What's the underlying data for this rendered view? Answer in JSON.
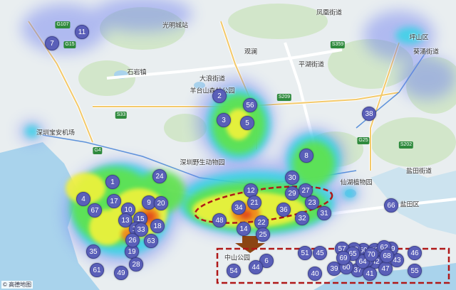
{
  "markers": [
    {
      "label": "1"
    },
    {
      "label": "2"
    },
    {
      "label": "3"
    },
    {
      "label": "4"
    },
    {
      "label": "5"
    },
    {
      "label": "6"
    },
    {
      "label": "7"
    },
    {
      "label": "8"
    },
    {
      "label": "9"
    },
    {
      "label": "10"
    },
    {
      "label": "11"
    },
    {
      "label": "12"
    },
    {
      "label": "13"
    },
    {
      "label": "14"
    },
    {
      "label": "15"
    },
    {
      "label": "16"
    },
    {
      "label": "17"
    },
    {
      "label": "18"
    },
    {
      "label": "19"
    },
    {
      "label": "20"
    },
    {
      "label": "21"
    },
    {
      "label": "22"
    },
    {
      "label": "23"
    },
    {
      "label": "24"
    },
    {
      "label": "25"
    },
    {
      "label": "26"
    },
    {
      "label": "27"
    },
    {
      "label": "28"
    },
    {
      "label": "29"
    },
    {
      "label": "30"
    },
    {
      "label": "31"
    },
    {
      "label": "32"
    },
    {
      "label": "33"
    },
    {
      "label": "34"
    },
    {
      "label": "35"
    },
    {
      "label": "36"
    },
    {
      "label": "37"
    },
    {
      "label": "38"
    },
    {
      "label": "39"
    },
    {
      "label": "40"
    },
    {
      "label": "41"
    },
    {
      "label": "42"
    },
    {
      "label": "43"
    },
    {
      "label": "44"
    },
    {
      "label": "45"
    },
    {
      "label": "46"
    },
    {
      "label": "47"
    },
    {
      "label": "48"
    },
    {
      "label": "49"
    },
    {
      "label": "50"
    },
    {
      "label": "51"
    },
    {
      "label": "52"
    },
    {
      "label": "53"
    },
    {
      "label": "54"
    },
    {
      "label": "55"
    },
    {
      "label": "56"
    },
    {
      "label": "57"
    },
    {
      "label": "58"
    },
    {
      "label": "59"
    },
    {
      "label": "60"
    },
    {
      "label": "61"
    },
    {
      "label": "62"
    },
    {
      "label": "63"
    },
    {
      "label": "64"
    },
    {
      "label": "65"
    },
    {
      "label": "66"
    },
    {
      "label": "67"
    },
    {
      "label": "68"
    },
    {
      "label": "69"
    },
    {
      "label": "70"
    }
  ],
  "places": [
    {
      "name": "光明城站"
    },
    {
      "name": "凤凰街道"
    },
    {
      "name": "石岩镇"
    },
    {
      "name": "大浪街道"
    },
    {
      "name": "观澜"
    },
    {
      "name": "平湖街道"
    },
    {
      "name": "深圳宝安机场"
    },
    {
      "name": "深圳野生动物园"
    },
    {
      "name": "仙湖植物园"
    },
    {
      "name": "盐田街道"
    },
    {
      "name": "盐田区"
    },
    {
      "name": "中山公园"
    },
    {
      "name": "羊台山森林公园"
    },
    {
      "name": "葵涌街道"
    },
    {
      "name": "坪山区"
    }
  ],
  "roads": [
    {
      "name": "G107"
    },
    {
      "name": "G15"
    },
    {
      "name": "S33"
    },
    {
      "name": "G4"
    },
    {
      "name": "S359"
    },
    {
      "name": "S209"
    },
    {
      "name": "G25"
    },
    {
      "name": "S202"
    }
  ],
  "attribution": "© 高德地图"
}
